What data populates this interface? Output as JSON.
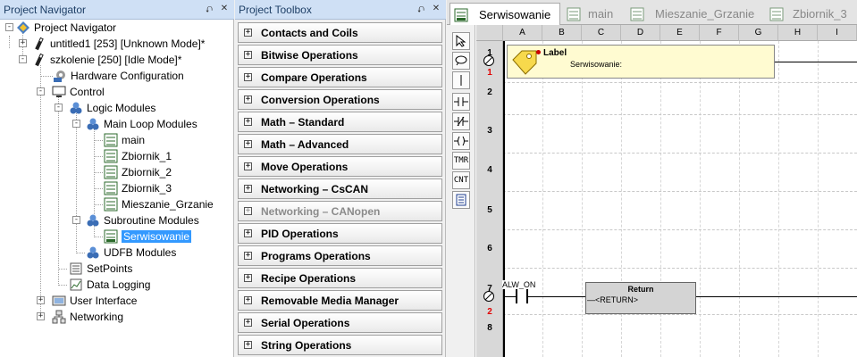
{
  "navigator": {
    "title": "Project Navigator",
    "items": [
      {
        "label": "Project Navigator"
      },
      {
        "label": "untitled1 [253] [Unknown Mode]*"
      },
      {
        "label": "szkolenie [250] [Idle Mode]*"
      },
      {
        "label": "Hardware Configuration"
      },
      {
        "label": "Control"
      },
      {
        "label": "Logic Modules"
      },
      {
        "label": "Main Loop Modules"
      },
      {
        "label": "main"
      },
      {
        "label": "Zbiornik_1"
      },
      {
        "label": "Zbiornik_2"
      },
      {
        "label": "Zbiornik_3"
      },
      {
        "label": "Mieszanie_Grzanie"
      },
      {
        "label": "Subroutine Modules"
      },
      {
        "label": "Serwisowanie"
      },
      {
        "label": "UDFB Modules"
      },
      {
        "label": "SetPoints"
      },
      {
        "label": "Data Logging"
      },
      {
        "label": "User Interface"
      },
      {
        "label": "Networking"
      }
    ]
  },
  "toolbox": {
    "title": "Project Toolbox",
    "items": [
      {
        "label": "Contacts and Coils"
      },
      {
        "label": "Bitwise Operations"
      },
      {
        "label": "Compare Operations"
      },
      {
        "label": "Conversion Operations"
      },
      {
        "label": "Math – Standard"
      },
      {
        "label": "Math – Advanced"
      },
      {
        "label": "Move Operations"
      },
      {
        "label": "Networking – CsCAN"
      },
      {
        "label": "Networking – CANopen"
      },
      {
        "label": "PID Operations"
      },
      {
        "label": "Programs Operations"
      },
      {
        "label": "Recipe Operations"
      },
      {
        "label": "Removable Media Manager"
      },
      {
        "label": "Serial Operations"
      },
      {
        "label": "String Operations"
      }
    ]
  },
  "editor": {
    "tabs": [
      {
        "label": "Serwisowanie"
      },
      {
        "label": "main"
      },
      {
        "label": "Mieszanie_Grzanie"
      },
      {
        "label": "Zbiornik_3"
      }
    ],
    "tools": [
      "TMR",
      "CNT"
    ],
    "columns": [
      "A",
      "B",
      "C",
      "D",
      "E",
      "F",
      "G",
      "H",
      "I"
    ],
    "rows": [
      "1",
      "2",
      "3",
      "4",
      "5",
      "6",
      "7",
      "8"
    ],
    "rung_counts": [
      "1",
      "2"
    ],
    "label_block": {
      "title": "Label",
      "text": "Serwisowanie:"
    },
    "contact_label": "ALW_ON",
    "return_block": {
      "title": "Return",
      "text": "—<RETURN>"
    }
  },
  "colors": {
    "selection": "#3399ff",
    "panel_title": "#cfe0f5",
    "rung_counter": "#e00000"
  }
}
